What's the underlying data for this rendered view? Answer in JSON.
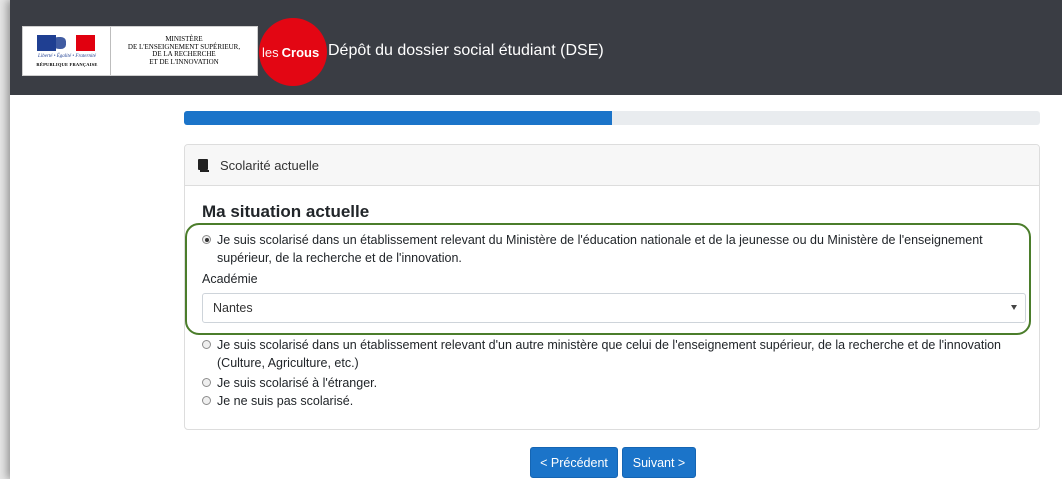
{
  "header": {
    "ministry_text": "MINISTÈRE\nDE L'ENSEIGNEMENT SUPÉRIEUR,\nDE LA RECHERCHE\nET DE L'INNOVATION",
    "motto": "Liberté • Égalité • Fraternité",
    "republic": "RÉPUBLIQUE FRANÇAISE",
    "crous_prefix": "les",
    "crous_name": "Crous",
    "app_title": "Dépôt du dossier social étudiant (DSE)"
  },
  "progress": {
    "value_percent": 50
  },
  "card": {
    "header_title": "Scolarité actuelle",
    "section_title": "Ma situation actuelle",
    "options": [
      {
        "label": "Je suis scolarisé dans un établissement relevant du Ministère de l'éducation nationale et de la jeunesse ou du Ministère de l'enseignement supérieur, de la recherche et de l'innovation.",
        "checked": true
      },
      {
        "label": "Je suis scolarisé dans un établissement relevant d'un autre ministère que celui de l'enseignement supérieur, de la recherche et de l'innovation (Culture, Agriculture, etc.)",
        "checked": false
      },
      {
        "label": "Je suis scolarisé à l'étranger.",
        "checked": false
      },
      {
        "label": "Je ne suis pas scolarisé.",
        "checked": false
      }
    ],
    "academie_label": "Académie",
    "academie_value": "Nantes"
  },
  "buttons": {
    "previous": "< Précédent",
    "next": "Suivant >"
  },
  "colors": {
    "header_bg": "#3a3d44",
    "accent_blue": "#1b74c9",
    "crous_red": "#e30613",
    "highlight_green": "#4b7d2b"
  }
}
